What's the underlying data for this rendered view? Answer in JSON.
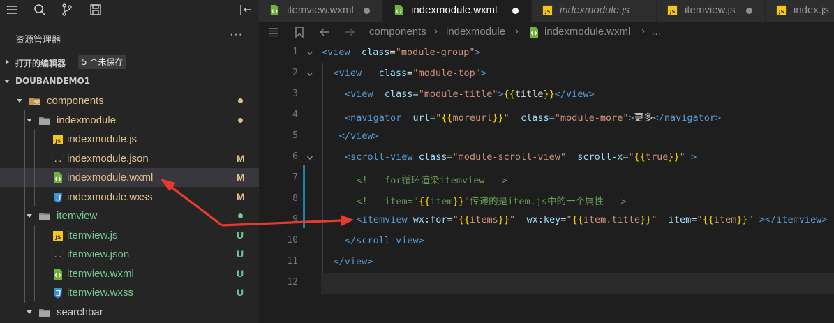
{
  "colors": {
    "accent_red": "#e8392f",
    "modified": "#e2c08d",
    "untracked": "#73c991",
    "tag": "#569cd6",
    "attr": "#9cdcfe",
    "string": "#ce9178",
    "brace": "#ffd700",
    "comment": "#6a9955"
  },
  "activity_icons": [
    "hamburger-icon",
    "search-icon",
    "branch-icon",
    "save-icon",
    "collapse-panel-icon"
  ],
  "sidebar": {
    "title": "资源管理器",
    "more": "···",
    "open_editors": {
      "label": "打开的编辑器",
      "badge": "5 个未保存"
    },
    "project": {
      "label": "DOUBANDEMO1"
    },
    "tree": [
      {
        "label": "components",
        "kind": "folder-components",
        "indent": 0,
        "expanded": true,
        "status": "dot",
        "color": "modified"
      },
      {
        "label": "indexmodule",
        "kind": "folder",
        "indent": 1,
        "expanded": true,
        "status": "dot",
        "color": "modified"
      },
      {
        "label": "indexmodule.js",
        "kind": "js",
        "indent": 2,
        "status": "",
        "color": "modified"
      },
      {
        "label": "indexmodule.json",
        "kind": "json",
        "indent": 2,
        "status": "M",
        "color": "modified"
      },
      {
        "label": "indexmodule.wxml",
        "kind": "wxml",
        "indent": 2,
        "status": "M",
        "color": "modified",
        "selected": true
      },
      {
        "label": "indexmodule.wxss",
        "kind": "wxss",
        "indent": 2,
        "status": "M",
        "color": "modified"
      },
      {
        "label": "itemview",
        "kind": "folder",
        "indent": 1,
        "expanded": true,
        "status": "dot",
        "color": "untracked"
      },
      {
        "label": "itemview.js",
        "kind": "js",
        "indent": 2,
        "status": "U",
        "color": "untracked"
      },
      {
        "label": "itemview.json",
        "kind": "json",
        "indent": 2,
        "status": "U",
        "color": "untracked"
      },
      {
        "label": "itemview.wxml",
        "kind": "wxml",
        "indent": 2,
        "status": "U",
        "color": "untracked"
      },
      {
        "label": "itemview.wxss",
        "kind": "wxss",
        "indent": 2,
        "status": "U",
        "color": "untracked"
      },
      {
        "label": "searchbar",
        "kind": "folder",
        "indent": 1,
        "expanded": true,
        "status": "",
        "color": "normal"
      }
    ]
  },
  "tabs": [
    {
      "label": "itemview.wxml",
      "kind": "wxml",
      "dirty": true,
      "active": false,
      "italic": false
    },
    {
      "label": "indexmodule.wxml",
      "kind": "wxml",
      "dirty": true,
      "active": true,
      "italic": false
    },
    {
      "label": "indexmodule.js",
      "kind": "js",
      "dirty": false,
      "active": false,
      "italic": true
    },
    {
      "label": "itemview.js",
      "kind": "js",
      "dirty": true,
      "active": false,
      "italic": false
    },
    {
      "label": "index.js",
      "kind": "js",
      "dirty": false,
      "active": false,
      "italic": false
    }
  ],
  "breadcrumb": {
    "parts": [
      "components",
      "indexmodule",
      "indexmodule.wxml",
      "…"
    ]
  },
  "code": {
    "lines": [
      {
        "n": "1",
        "indent": 0,
        "fold": true,
        "tokens": [
          [
            "t",
            "<view"
          ],
          [
            "p",
            "  "
          ],
          [
            "a",
            "class"
          ],
          [
            "p",
            "="
          ],
          [
            "s",
            "\"module-group\""
          ],
          [
            "t",
            ">"
          ]
        ]
      },
      {
        "n": "2",
        "indent": 1,
        "fold": true,
        "tokens": [
          [
            "t",
            "<view"
          ],
          [
            "p",
            "   "
          ],
          [
            "a",
            "class"
          ],
          [
            "p",
            "="
          ],
          [
            "s",
            "\"module-top\""
          ],
          [
            "t",
            ">"
          ]
        ]
      },
      {
        "n": "3",
        "indent": 2,
        "fold": false,
        "tokens": [
          [
            "t",
            "<view"
          ],
          [
            "p",
            "  "
          ],
          [
            "a",
            "class"
          ],
          [
            "p",
            "="
          ],
          [
            "s",
            "\"module-title\""
          ],
          [
            "t",
            ">"
          ],
          [
            "b",
            "{{"
          ],
          [
            "p",
            "title"
          ],
          [
            "b",
            "}}"
          ],
          [
            "t",
            "</view>"
          ]
        ]
      },
      {
        "n": "4",
        "indent": 2,
        "fold": false,
        "tokens": [
          [
            "t",
            "<navigator"
          ],
          [
            "p",
            "  "
          ],
          [
            "a",
            "url"
          ],
          [
            "p",
            "="
          ],
          [
            "s",
            "\""
          ],
          [
            "b",
            "{{"
          ],
          [
            "s",
            "moreurl"
          ],
          [
            "b",
            "}}"
          ],
          [
            "s",
            "\""
          ],
          [
            "p",
            "  "
          ],
          [
            "a",
            "class"
          ],
          [
            "p",
            "="
          ],
          [
            "s",
            "\"module-more\""
          ],
          [
            "t",
            ">"
          ],
          [
            "p",
            "更多"
          ],
          [
            "t",
            "</navigator>"
          ]
        ]
      },
      {
        "n": "5",
        "indent": 1.5,
        "fold": false,
        "tokens": [
          [
            "t",
            "</view>"
          ]
        ]
      },
      {
        "n": "6",
        "indent": 2,
        "fold": true,
        "tokens": [
          [
            "t",
            "<scroll-view"
          ],
          [
            "p",
            " "
          ],
          [
            "a",
            "class"
          ],
          [
            "p",
            "="
          ],
          [
            "s",
            "\"module-scroll-view\""
          ],
          [
            "p",
            "  "
          ],
          [
            "a",
            "scroll-x"
          ],
          [
            "p",
            "="
          ],
          [
            "s",
            "\""
          ],
          [
            "b",
            "{{"
          ],
          [
            "s",
            "true"
          ],
          [
            "b",
            "}}"
          ],
          [
            "s",
            "\""
          ],
          [
            "p",
            " "
          ],
          [
            "t",
            ">"
          ]
        ]
      },
      {
        "n": "7",
        "indent": 3,
        "fold": false,
        "tokens": [
          [
            "c",
            "<!-- for循环渲染itemview -->"
          ]
        ]
      },
      {
        "n": "8",
        "indent": 3,
        "fold": false,
        "tokens": [
          [
            "c",
            "<!-- item=\""
          ],
          [
            "b",
            "{{"
          ],
          [
            "c",
            "item"
          ],
          [
            "b",
            "}}"
          ],
          [
            "c",
            "\"传递的是item.js中的一个属性 -->"
          ]
        ]
      },
      {
        "n": "9",
        "indent": 3,
        "fold": false,
        "tokens": [
          [
            "t",
            "<itemview"
          ],
          [
            "p",
            " "
          ],
          [
            "a",
            "wx:for"
          ],
          [
            "p",
            "="
          ],
          [
            "s",
            "\""
          ],
          [
            "b",
            "{{"
          ],
          [
            "s",
            "items"
          ],
          [
            "b",
            "}}"
          ],
          [
            "s",
            "\""
          ],
          [
            "p",
            "  "
          ],
          [
            "a",
            "wx:key"
          ],
          [
            "p",
            "="
          ],
          [
            "s",
            "\""
          ],
          [
            "b",
            "{{"
          ],
          [
            "s",
            "item.title"
          ],
          [
            "b",
            "}}"
          ],
          [
            "s",
            "\""
          ],
          [
            "p",
            "  "
          ],
          [
            "a",
            "item"
          ],
          [
            "p",
            "="
          ],
          [
            "s",
            "\""
          ],
          [
            "b",
            "{{"
          ],
          [
            "s",
            "item"
          ],
          [
            "b",
            "}}"
          ],
          [
            "s",
            "\""
          ],
          [
            "p",
            " "
          ],
          [
            "t",
            "></itemview>"
          ]
        ]
      },
      {
        "n": "10",
        "indent": 2,
        "fold": false,
        "tokens": [
          [
            "t",
            "</scroll-view>"
          ]
        ]
      },
      {
        "n": "11",
        "indent": 1,
        "fold": false,
        "tokens": [
          [
            "t",
            "</view>"
          ]
        ]
      },
      {
        "n": "12",
        "indent": 0,
        "fold": false,
        "current": true,
        "tokens": []
      }
    ]
  }
}
